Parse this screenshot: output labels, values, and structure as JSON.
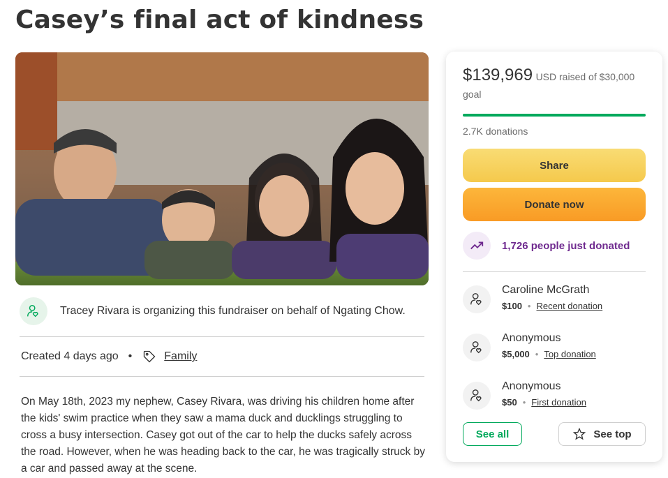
{
  "page": {
    "title": "Casey’s final act of kindness"
  },
  "photo": {
    "description_icon": "family-photo"
  },
  "organizer": {
    "icon": "user-heart-icon",
    "text": "Tracey Rivara is organizing this fundraiser on behalf of Ngating Chow."
  },
  "meta": {
    "created": "Created 4 days ago",
    "separator": "•",
    "tag_icon": "tag-icon",
    "category": "Family"
  },
  "story": {
    "text": "On May 18th, 2023 my nephew, Casey Rivara, was driving his children home after the kids' swim practice when they saw a mama duck and ducklings struggling to cross a busy intersection. Casey got out of the car to help the ducks safely across the road. However, when he was heading back to the car, he was tragically struck by a car and passed away at the scene."
  },
  "sidebar": {
    "amount": "$139,969",
    "goal_text": "USD raised of $30,000 goal",
    "progress_fraction": 1.0,
    "donation_count": "2.7K donations",
    "share_label": "Share",
    "donate_label": "Donate now",
    "just_donated": "1,726 people just donated",
    "donors": [
      {
        "name": "Caroline McGrath",
        "amount": "$100",
        "label": "Recent donation"
      },
      {
        "name": "Anonymous",
        "amount": "$5,000",
        "label": "Top donation"
      },
      {
        "name": "Anonymous",
        "amount": "$50",
        "label": "First donation"
      }
    ],
    "see_all_label": "See all",
    "see_top_label": "See top"
  },
  "colors": {
    "brand_green": "#02a95c",
    "share_yellow": "#f7d15c",
    "donate_orange": "#faa52f",
    "purple": "#6f2a8f"
  }
}
